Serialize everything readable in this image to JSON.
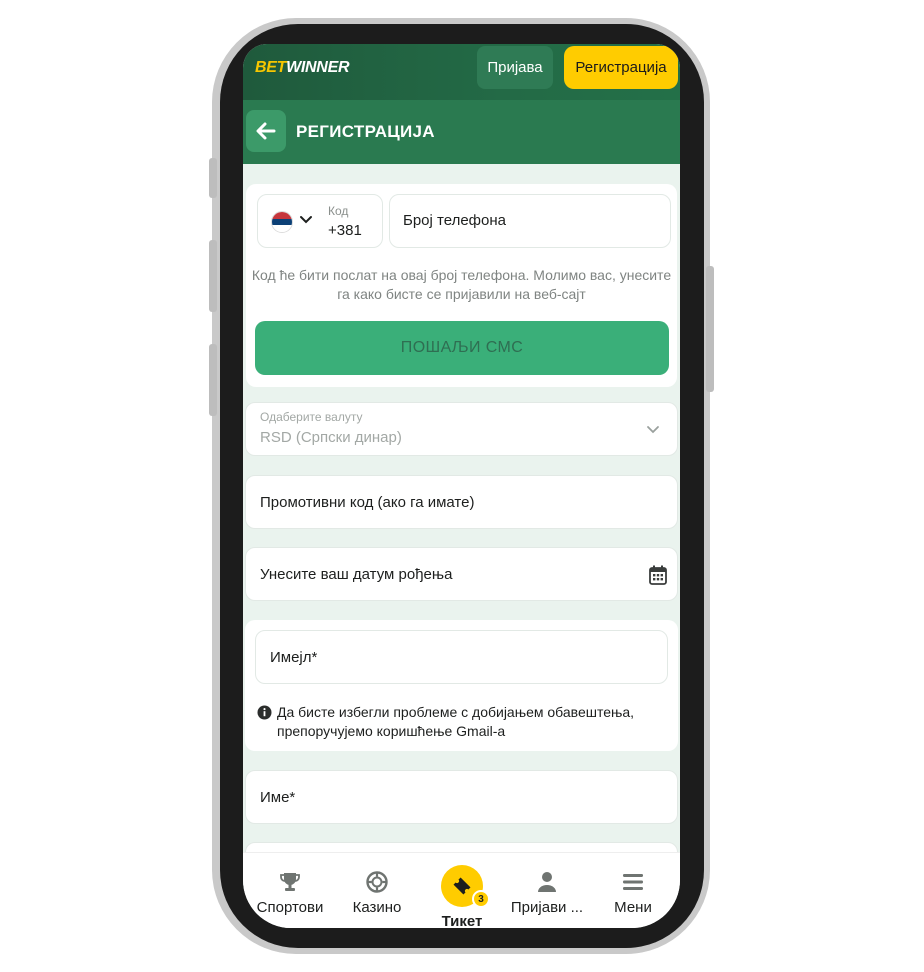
{
  "topbar": {
    "logo_bet": "BET",
    "logo_winner": "WINNER",
    "login_label": "Пријава",
    "register_label": "Регистрација"
  },
  "header": {
    "back_icon": "arrow-left-icon",
    "title": "РЕГИСТРАЦИЈА"
  },
  "phone_section": {
    "country_flag": "serbia-flag-icon",
    "code_label": "Код",
    "code_value": "+381",
    "phone_placeholder": "Број телефона",
    "sms_note": "Код ће бити послат на овај број телефона. Молимо вас, унесите га како бисте се пријавили на веб-сајт",
    "send_sms_label": "ПОШАЉИ СМС"
  },
  "currency": {
    "label": "Одаберите валуту",
    "value": "RSD  (Српски динар)"
  },
  "promo": {
    "placeholder": "Промотивни код (ако га имате)"
  },
  "dob": {
    "placeholder": "Унесите ваш датум рођења",
    "icon": "calendar-icon"
  },
  "email": {
    "placeholder": "Имејл*",
    "note": "Да бисте избегли проблеме с добијањем обавештења, препоручујемо коришћење Gmail-а"
  },
  "name": {
    "placeholder": "Име*"
  },
  "bottom_nav": {
    "sports": "Спортови",
    "casino": "Казино",
    "ticket": "Тикет",
    "ticket_count": "3",
    "login": "Пријави ...",
    "menu": "Мени"
  },
  "colors": {
    "brand_green": "#2a7a50",
    "accent_yellow": "#ffcc00",
    "sms_button": "#3aaf79"
  }
}
